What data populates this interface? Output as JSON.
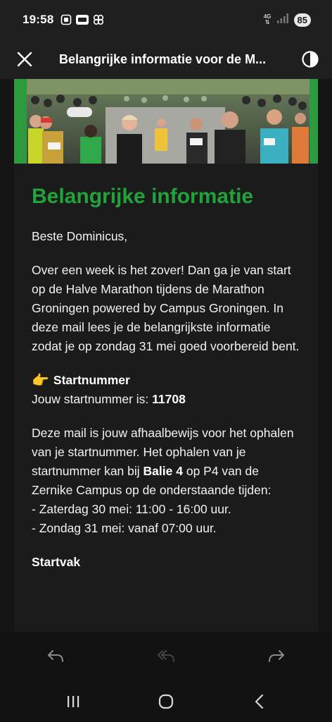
{
  "status_bar": {
    "time": "19:58",
    "network_top": "4G",
    "battery": "85",
    "icons": [
      "screenshot-icon",
      "app-badge-icon",
      "pinwheel-icon",
      "data-arrows-icon",
      "signal-icon"
    ]
  },
  "app_bar": {
    "title": "Belangrijke informatie voor de M...",
    "close_icon": "close-icon",
    "theme_icon": "contrast-icon"
  },
  "email": {
    "heading": "Belangrijke informatie",
    "greeting": "Beste Dominicus,",
    "intro": "Over een week is het zover! Dan ga je van start op de Halve Marathon tijdens de Marathon Groningen powered by Campus Groningen. In deze mail lees je de belangrijkste informatie zodat je op zondag 31 mei goed voorbereid bent.",
    "startnummer_icon": "👉",
    "startnummer_title": "Startnummer",
    "startnummer_prefix": "Jouw startnummer is: ",
    "startnummer_value": "11708",
    "pickup_text_1": "Deze mail is jouw afhaalbewijs voor het ophalen van je startnummer. Het ophalen van je startnummer kan bij ",
    "pickup_location": "Balie 4",
    "pickup_text_2": " op P4 van de Zernike Campus op de onderstaande tijden:",
    "time_1": "- Zaterdag 30 mei: 11:00 - 16:00 uur.",
    "time_2": "- Zondag 31 mei: vanaf 07:00 uur.",
    "startvak_title": "Startvak"
  },
  "bottom_actions": [
    "reply-icon",
    "reply-all-icon",
    "forward-icon"
  ],
  "system_nav": [
    "recent-apps-icon",
    "home-icon",
    "back-icon"
  ],
  "colors": {
    "accent_green": "#1fa33b",
    "background": "#151515",
    "bar": "#1f1f1f"
  }
}
